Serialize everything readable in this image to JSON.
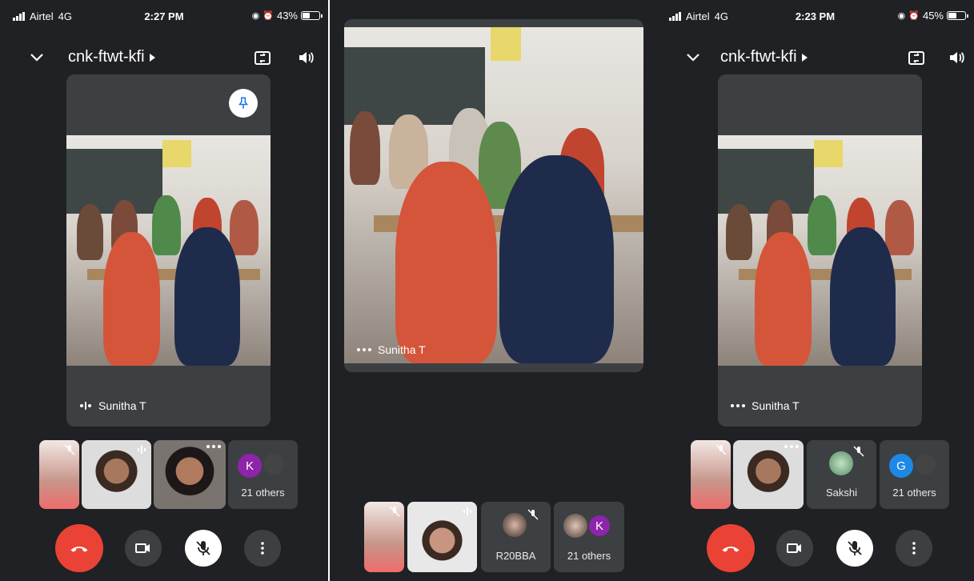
{
  "left": {
    "status": {
      "carrier": "Airtel",
      "network": "4G",
      "time": "2:27 PM",
      "battery": "43%",
      "battery_level": 0.43
    },
    "meeting_code": "cnk-ftwt-kfi",
    "main_tile": {
      "name": "Sunitha T"
    },
    "thumbs": [
      {
        "icon": "muted-mic-icon"
      },
      {
        "icon": "audio-level-icon"
      },
      {
        "icon": "more-dots-icon"
      }
    ],
    "others": {
      "label": "21 others",
      "avatar_letter": "K",
      "avatar_color": "#8e24aa"
    }
  },
  "middle": {
    "main_tile": {
      "name": "Sunitha T"
    },
    "thumbs": [
      {
        "icon": "muted-mic-icon"
      },
      {
        "icon": "audio-level-icon"
      }
    ],
    "participant": {
      "name": "R20BBA",
      "icon": "muted-mic-icon"
    },
    "others": {
      "label": "21 others",
      "avatar_letter": "K",
      "avatar_color": "#8e24aa"
    }
  },
  "right": {
    "status": {
      "carrier": "Airtel",
      "network": "4G",
      "time": "2:23 PM",
      "battery": "45%",
      "battery_level": 0.45
    },
    "meeting_code": "cnk-ftwt-kfi",
    "main_tile": {
      "name": "Sunitha T"
    },
    "thumbs": [
      {
        "icon": "muted-mic-icon"
      },
      {
        "icon": "more-dots-icon"
      }
    ],
    "participant": {
      "name": "Sakshi",
      "icon": "muted-mic-icon"
    },
    "others": {
      "label": "21 others",
      "avatar_letter": "G",
      "avatar_color": "#1e88e5"
    }
  },
  "controls": {
    "end_call": "end-call-icon",
    "camera": "camera-off-icon",
    "microphone": "mic-off-icon",
    "more": "more-options-icon",
    "end_color": "#ea4335"
  }
}
